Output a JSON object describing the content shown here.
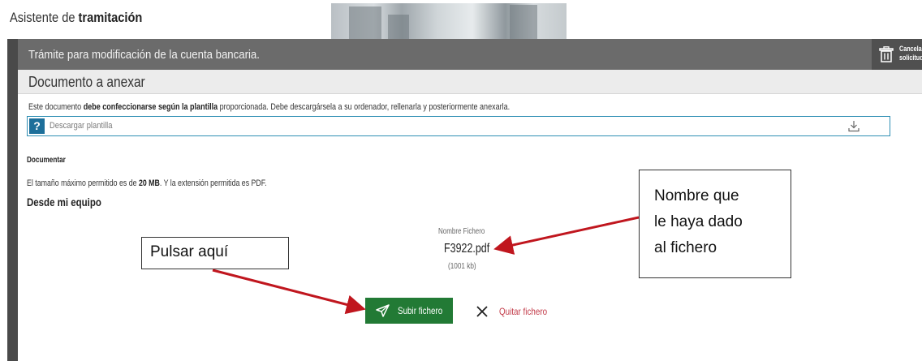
{
  "header": {
    "app_title_prefix": "Asistente de",
    "app_title_bold": "tramitación"
  },
  "title_bar": {
    "tramite": "Trámite para modificación de la cuenta bancaria.",
    "cancel_label_line1": "Cancela",
    "cancel_label_line2": "solicitud"
  },
  "section": {
    "title": "Documento a anexar",
    "note_prefix": "Este documento",
    "note_bold": "debe confeccionarse según la plantilla",
    "note_suffix": "proporcionada. Debe descargársela a su ordenador, rellenarla y posteriormente anexarla.",
    "template_label": "Descargar plantilla"
  },
  "documentar": {
    "heading": "Documentar",
    "size_note_prefix": "El tamaño máximo permitido es de",
    "size_note_bold": "20 MB",
    "size_note_suffix": ". Y la extensión permitida es PDF.",
    "source_label": "Desde mi equipo"
  },
  "file": {
    "column_label": "Nombre Fichero",
    "name": "F3922.pdf",
    "size": "(1001 kb)"
  },
  "actions": {
    "upload_label": "Subir fichero",
    "remove_label": "Quitar fichero"
  },
  "annotations": {
    "pulsar": "Pulsar aquí",
    "nombre": "Nombre que\nle haya dado\nal fichero"
  },
  "colors": {
    "title_bar": "#6b6b6b",
    "upload_button": "#227a35",
    "remove_link": "#c23a48",
    "template_border": "#2f8fb4",
    "help_icon": "#1d6f9a",
    "arrow": "#c0161e"
  },
  "icons": {
    "help": "question-icon",
    "download": "download-icon",
    "trash": "trash-icon",
    "send": "paper-plane-icon",
    "remove": "close-icon"
  }
}
